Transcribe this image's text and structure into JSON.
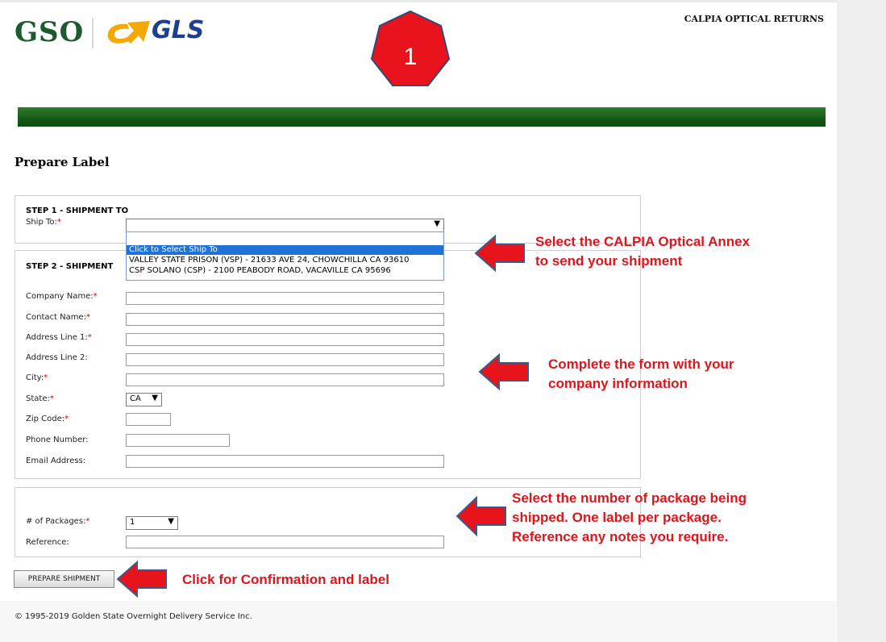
{
  "header": {
    "logo_left": "GSO",
    "logo_right": "GLS",
    "brand_title": "CALPIA OPTICAL RETURNS",
    "badge_number": "1"
  },
  "page": {
    "title": "Prepare Label"
  },
  "step1": {
    "title": "STEP 1 - SHIPMENT TO",
    "ship_to_label": "Ship To:",
    "ship_to_value": "",
    "options": [
      "Click to Select Ship To",
      "VALLEY STATE PRISON (VSP) - 21633 AVE 24, CHOWCHILLA CA 93610",
      "CSP SOLANO (CSP) - 2100 PEABODY ROAD, VACAVILLE CA 95696"
    ]
  },
  "step2": {
    "title": "STEP 2 - SHIPMENT",
    "fields": {
      "company": "Company Name:",
      "contact": "Contact Name:",
      "addr1": "Address Line 1:",
      "addr2": "Address Line 2:",
      "city": "City:",
      "state": "State:",
      "zip": "Zip Code:",
      "phone": "Phone Number:",
      "email": "Email Address:"
    },
    "state_value": "CA"
  },
  "step3": {
    "packages_label": "# of Packages:",
    "packages_value": "1",
    "reference_label": "Reference:"
  },
  "button": {
    "label": "PREPARE SHIPMENT"
  },
  "required_mark": "*",
  "annotations": {
    "note1_line1": "Select the CALPIA Optical Annex",
    "note1_line2": "to send your shipment",
    "note2_line1": "Complete the form with your",
    "note2_line2": "company information",
    "note3_line1": "Select the number of package being",
    "note3_line2": "shipped. One label per package.",
    "note3_line3": "Reference any notes you require.",
    "note4": "Click for Confirmation and label"
  },
  "footer": {
    "copyright": "© 1995-2019 Golden State Overnight Delivery Service Inc."
  },
  "colors": {
    "green": "#155a16",
    "annotation_red": "#e0141b",
    "highlight_blue": "#1e72d8"
  }
}
